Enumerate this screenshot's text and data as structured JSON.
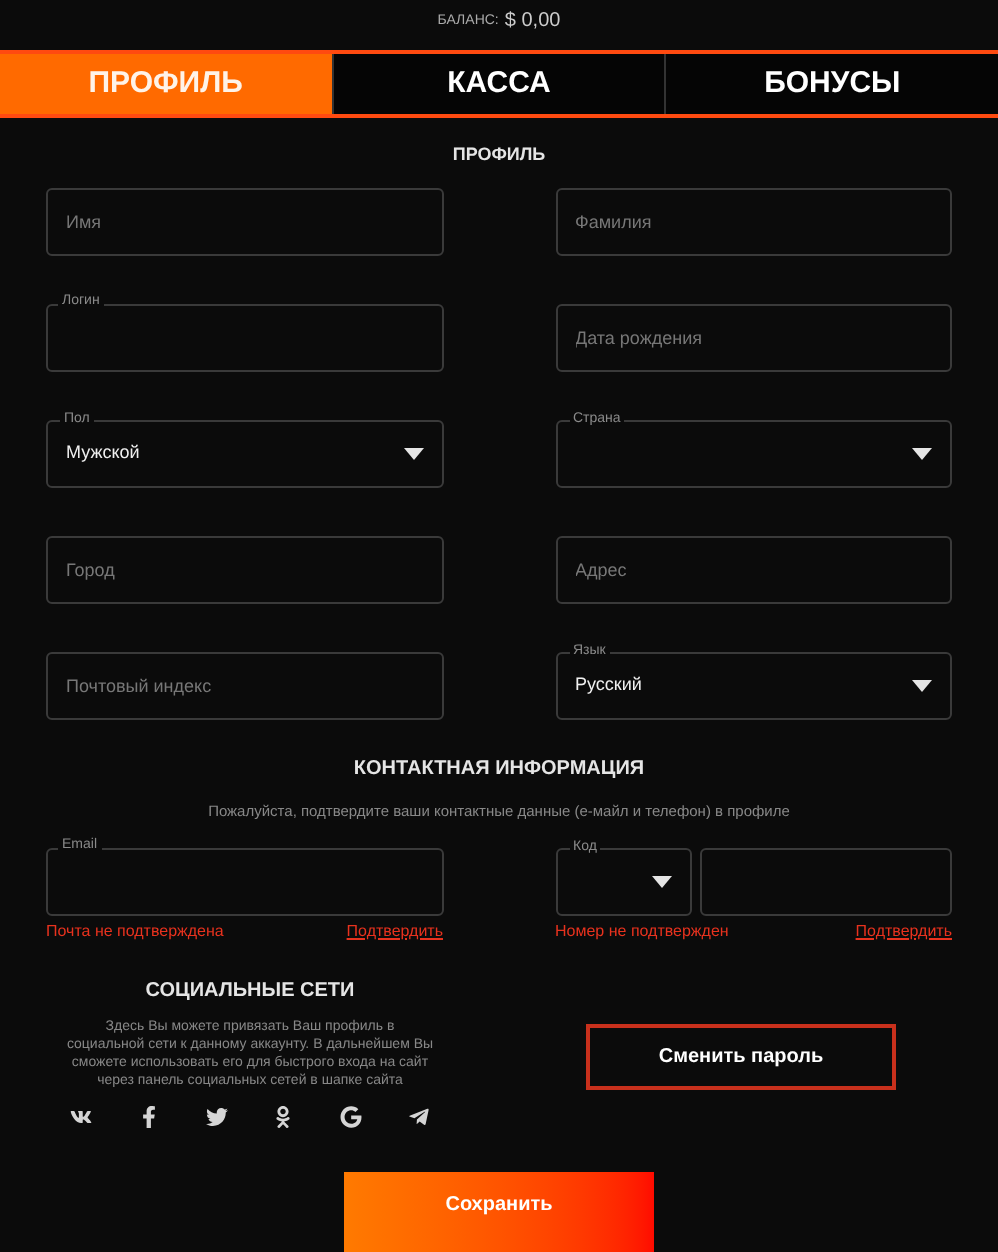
{
  "balance": {
    "label": "БАЛАНС:",
    "value": "$ 0,00"
  },
  "tabs": [
    {
      "label": "ПРОФИЛЬ",
      "selected": true
    },
    {
      "label": "КАССА",
      "selected": false
    },
    {
      "label": "БОНУСЫ",
      "selected": false
    }
  ],
  "profile_heading": "ПРОФИЛЬ",
  "field_rows": [
    {
      "left": {
        "kind": "input",
        "placeholder": "Имя"
      },
      "right": {
        "kind": "input",
        "placeholder": "Фамилия"
      }
    },
    {
      "left": {
        "kind": "input",
        "label": "Логин"
      },
      "right": {
        "kind": "input",
        "placeholder": "Дата рождения"
      }
    },
    {
      "left": {
        "kind": "select",
        "label": "Пол",
        "value": "Мужской"
      },
      "right": {
        "kind": "select",
        "label": "Страна"
      }
    },
    {
      "left": {
        "kind": "input",
        "placeholder": "Город"
      },
      "right": {
        "kind": "input",
        "placeholder": "Адрес"
      }
    },
    {
      "left": {
        "kind": "input",
        "placeholder": "Почтовый индекс"
      },
      "right": {
        "kind": "select",
        "label": "Язык",
        "value": "Русский"
      }
    }
  ],
  "contact": {
    "heading": "КОНТАКТНАЯ ИНФОРМАЦИЯ",
    "note": "Пожалуйста, подтвердите ваши контактные данные (е-майл и телефон) в профиле",
    "email": {
      "label": "Email",
      "status": "Почта не подтверждена",
      "confirm": "Подтвердить"
    },
    "phone": {
      "code_label": "Код",
      "status": "Номер не подтвержден",
      "confirm": "Подтвердить"
    }
  },
  "social": {
    "heading": "СОЦИАЛЬНЫЕ СЕТИ",
    "text": "Здесь Вы можете привязать Ваш профиль в социальной сети к данному аккаунту. В дальнейшем Вы сможете использовать его для быстрого входа на сайт через панель социальных сетей в шапке сайта",
    "networks": [
      {
        "kind": "vk"
      },
      {
        "kind": "facebook"
      },
      {
        "kind": "twitter"
      },
      {
        "kind": "odnoklassniki"
      },
      {
        "kind": "google"
      },
      {
        "kind": "telegram"
      }
    ]
  },
  "change_password": "Сменить пароль",
  "save": "Сохранить"
}
